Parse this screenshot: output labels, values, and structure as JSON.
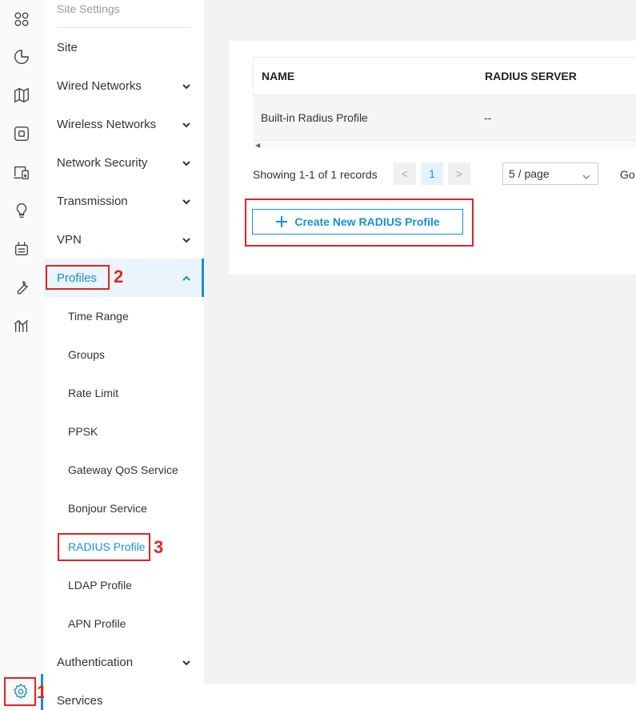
{
  "rail": {
    "icons": [
      "apps-icon",
      "pie-chart-icon",
      "map-icon",
      "device-icon",
      "devices-monitor-icon",
      "lightbulb-icon",
      "router-icon",
      "wrench-icon",
      "statistics-icon",
      "gear-icon"
    ]
  },
  "menu": {
    "header": "Site Settings",
    "items": [
      {
        "label": "Site"
      },
      {
        "label": "Wired Networks"
      },
      {
        "label": "Wireless Networks"
      },
      {
        "label": "Network Security"
      },
      {
        "label": "Transmission"
      },
      {
        "label": "VPN"
      },
      {
        "label": "Profiles"
      },
      {
        "label": "Authentication"
      },
      {
        "label": "Services"
      }
    ],
    "profiles_sub": [
      {
        "label": "Time Range"
      },
      {
        "label": "Groups"
      },
      {
        "label": "Rate Limit"
      },
      {
        "label": "PPSK"
      },
      {
        "label": "Gateway QoS Service"
      },
      {
        "label": "Bonjour Service"
      },
      {
        "label": "RADIUS Profile"
      },
      {
        "label": "LDAP Profile"
      },
      {
        "label": "APN Profile"
      }
    ]
  },
  "annotations": {
    "step1": "1",
    "step2": "2",
    "step3": "3"
  },
  "table": {
    "columns": [
      "NAME",
      "RADIUS SERVER"
    ],
    "rows": [
      {
        "name": "Built-in Radius Profile",
        "server": "--"
      }
    ]
  },
  "pagination": {
    "showing": "Showing 1-1 of 1 records",
    "prev": "<",
    "current_page": "1",
    "next": ">",
    "page_size": "5 / page",
    "goto": "Go"
  },
  "actions": {
    "create_label": "Create New RADIUS Profile"
  },
  "colors": {
    "accent": "#1890d6",
    "highlight": "#e02424",
    "selected_bg": "#e9f4fc"
  }
}
